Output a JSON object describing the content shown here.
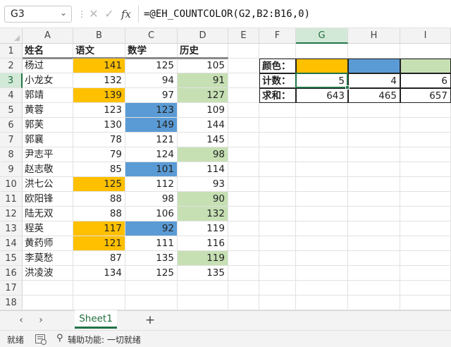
{
  "name_box": {
    "value": "G3"
  },
  "formula_bar": {
    "formula": "=@EH_COUNTCOLOR(G2,B2:B16,0)"
  },
  "columns": [
    "A",
    "B",
    "C",
    "D",
    "E",
    "F",
    "G",
    "H",
    "I"
  ],
  "selected_column": "G",
  "rows": [
    "1",
    "2",
    "3",
    "4",
    "5",
    "6",
    "7",
    "8",
    "9",
    "10",
    "11",
    "12",
    "13",
    "14",
    "15",
    "16",
    "17",
    "18"
  ],
  "selected_row": "3",
  "colors": {
    "orange": "#ffc000",
    "blue": "#5b9bd5",
    "green": "#c6e0b4",
    "accent": "#217346"
  },
  "table": {
    "headers": [
      "姓名",
      "语文",
      "数学",
      "历史"
    ],
    "rows": [
      {
        "name": "杨过",
        "chinese": 141,
        "math": 125,
        "history": 105,
        "fills": [
          "orange",
          "",
          ""
        ]
      },
      {
        "name": "小龙女",
        "chinese": 132,
        "math": 94,
        "history": 91,
        "fills": [
          "",
          "",
          "green"
        ]
      },
      {
        "name": "郭靖",
        "chinese": 139,
        "math": 97,
        "history": 127,
        "fills": [
          "orange",
          "",
          "green"
        ]
      },
      {
        "name": "黄蓉",
        "chinese": 123,
        "math": 123,
        "history": 109,
        "fills": [
          "",
          "blue",
          ""
        ]
      },
      {
        "name": "郭芙",
        "chinese": 130,
        "math": 149,
        "history": 144,
        "fills": [
          "",
          "blue",
          ""
        ]
      },
      {
        "name": "郭襄",
        "chinese": 78,
        "math": 121,
        "history": 145,
        "fills": [
          "",
          "",
          ""
        ]
      },
      {
        "name": "尹志平",
        "chinese": 79,
        "math": 124,
        "history": 98,
        "fills": [
          "",
          "",
          "green"
        ]
      },
      {
        "name": "赵志敬",
        "chinese": 85,
        "math": 101,
        "history": 114,
        "fills": [
          "",
          "blue",
          ""
        ]
      },
      {
        "name": "洪七公",
        "chinese": 125,
        "math": 112,
        "history": 93,
        "fills": [
          "orange",
          "",
          ""
        ]
      },
      {
        "name": "欧阳锋",
        "chinese": 88,
        "math": 98,
        "history": 90,
        "fills": [
          "",
          "",
          "green"
        ]
      },
      {
        "name": "陆无双",
        "chinese": 88,
        "math": 106,
        "history": 132,
        "fills": [
          "",
          "",
          "green"
        ]
      },
      {
        "name": "程英",
        "chinese": 117,
        "math": 92,
        "history": 119,
        "fills": [
          "orange",
          "blue",
          ""
        ]
      },
      {
        "name": "黄药师",
        "chinese": 121,
        "math": 111,
        "history": 116,
        "fills": [
          "orange",
          "",
          ""
        ]
      },
      {
        "name": "李莫愁",
        "chinese": 87,
        "math": 135,
        "history": 119,
        "fills": [
          "",
          "",
          "green"
        ]
      },
      {
        "name": "洪凌波",
        "chinese": 134,
        "math": 125,
        "history": 135,
        "fills": [
          "",
          "",
          ""
        ]
      }
    ]
  },
  "summary": {
    "color_label": "颜色：",
    "count_label": "计数：",
    "sum_label": "求和：",
    "swatches": [
      "orange",
      "blue",
      "green"
    ],
    "counts": [
      5,
      4,
      6
    ],
    "sums": [
      643,
      465,
      657
    ]
  },
  "sheet_tabs": {
    "active": "Sheet1",
    "add_label": "+"
  },
  "status_bar": {
    "ready": "就绪",
    "accessibility": "辅助功能: 一切就绪"
  }
}
